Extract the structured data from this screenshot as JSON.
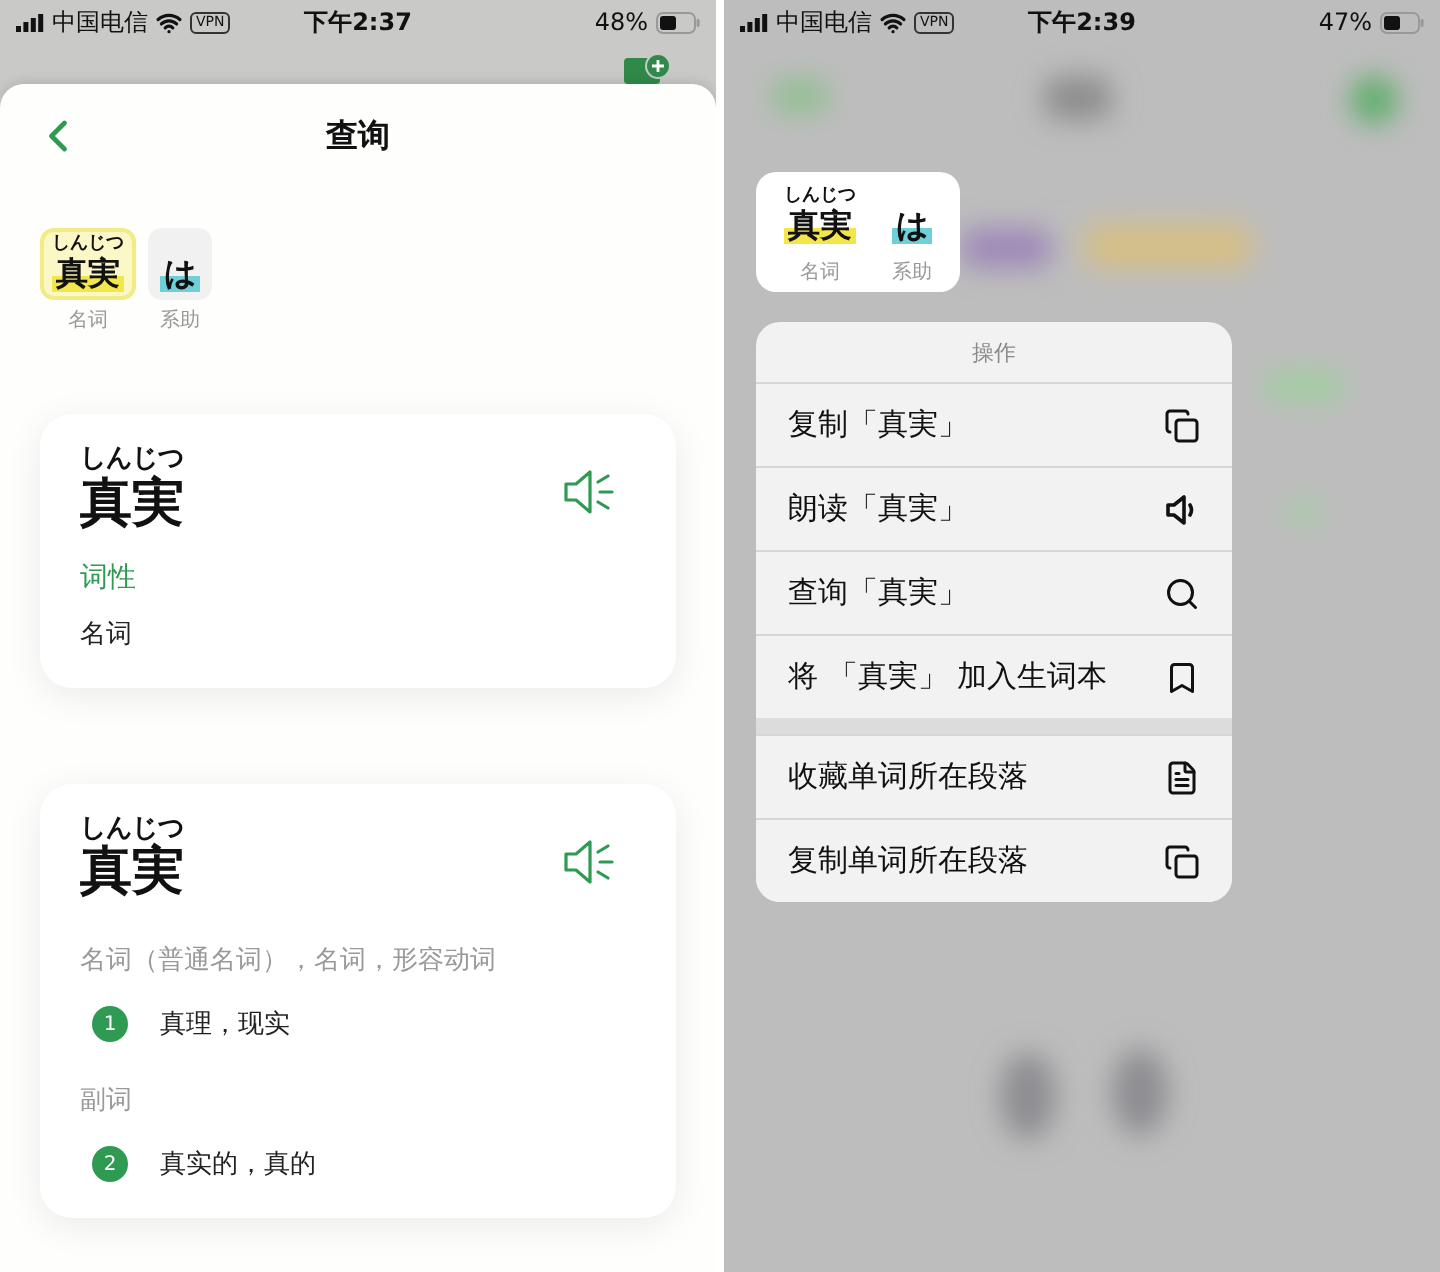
{
  "left_screen": {
    "status_bar": {
      "carrier": "中国电信",
      "vpn": "VPN",
      "time": "下午2:37",
      "battery": "48%"
    },
    "sheet": {
      "title": "查询",
      "tokens": [
        {
          "reading": "しんじつ",
          "word": "真実",
          "pos": "名词",
          "selected": true,
          "color": "#f3e64a"
        },
        {
          "word": "は",
          "pos": "系助",
          "selected": false,
          "color": "#6fd0da"
        }
      ],
      "summary_card": {
        "reading": "しんじつ",
        "word": "真実",
        "label": "词性",
        "value": "名词"
      },
      "detail_card": {
        "reading": "しんじつ",
        "word": "真実",
        "senses": [
          {
            "pos": "名词（普通名词），名词，形容动词",
            "number": "1",
            "meaning": "真理，现实"
          },
          {
            "pos": "副词",
            "number": "2",
            "meaning": "真实的，真的"
          }
        ]
      }
    }
  },
  "right_screen": {
    "status_bar": {
      "carrier": "中国电信",
      "vpn": "VPN",
      "time": "下午2:39",
      "battery": "47%"
    },
    "tokens": [
      {
        "reading": "しんじつ",
        "word": "真実",
        "pos": "名词",
        "color": "#f3e64a"
      },
      {
        "word": "は",
        "pos": "系助",
        "color": "#6fd0da"
      }
    ],
    "menu": {
      "title": "操作",
      "groups": [
        [
          {
            "label": "复制「真実」",
            "kind": "copy"
          },
          {
            "label": "朗读「真実」",
            "kind": "speaker"
          },
          {
            "label": "查询「真実」",
            "kind": "search"
          },
          {
            "label": "将 「真実」 加入生词本",
            "kind": "bookmark"
          }
        ],
        [
          {
            "label": "收藏单词所在段落",
            "kind": "document"
          },
          {
            "label": "复制单词所在段落",
            "kind": "copy"
          }
        ]
      ]
    }
  }
}
